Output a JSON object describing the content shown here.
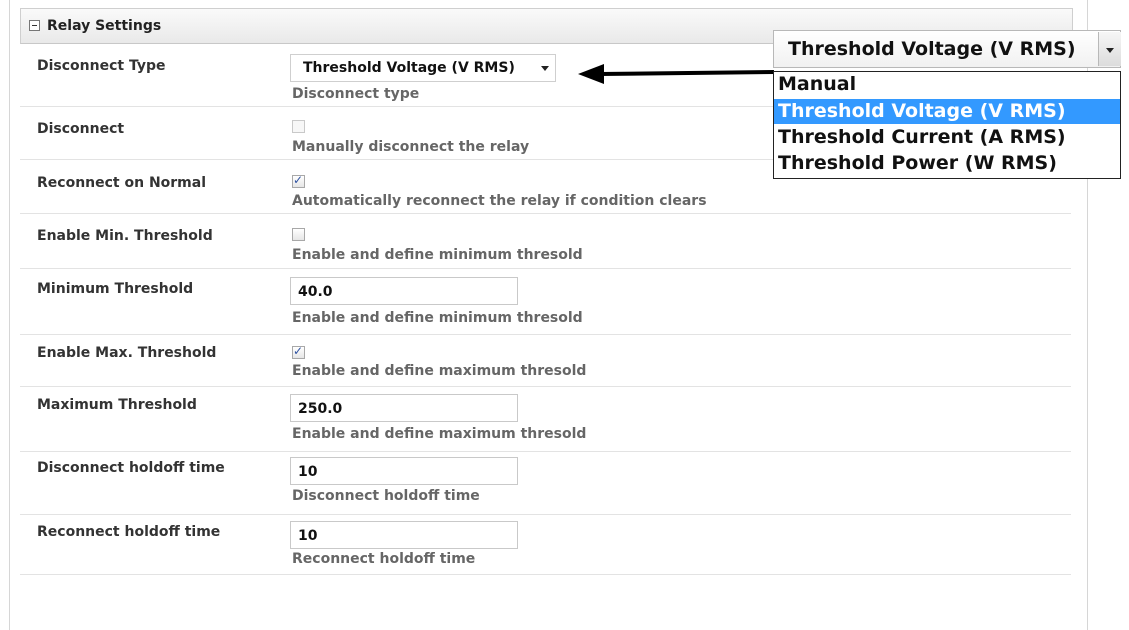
{
  "section": {
    "title": "Relay Settings"
  },
  "rows": [
    {
      "label": "Disconnect Type",
      "hint": "Disconnect type",
      "value": "Threshold Voltage (V RMS)"
    },
    {
      "label": "Disconnect",
      "hint": "Manually disconnect the relay",
      "checked": false
    },
    {
      "label": "Reconnect on Normal",
      "hint": "Automatically reconnect the relay if condition clears",
      "checked": true
    },
    {
      "label": "Enable Min. Threshold",
      "hint": "Enable and define minimum thresold",
      "checked": false
    },
    {
      "label": "Minimum Threshold",
      "hint": "Enable and define minimum thresold",
      "value": "40.0"
    },
    {
      "label": "Enable Max. Threshold",
      "hint": "Enable and define maximum thresold",
      "checked": true
    },
    {
      "label": "Maximum Threshold",
      "hint": "Enable and define maximum thresold",
      "value": "250.0"
    },
    {
      "label": "Disconnect holdoff time",
      "hint": "Disconnect holdoff time",
      "value": "10"
    },
    {
      "label": "Reconnect holdoff time",
      "hint": "Reconnect holdoff time",
      "value": "10"
    }
  ],
  "dropdown": {
    "selected": "Threshold Voltage (V RMS)",
    "options": [
      "Manual",
      "Threshold Voltage (V RMS)",
      "Threshold Current (A RMS)",
      "Threshold Power (W RMS)"
    ]
  },
  "colors": {
    "highlight": "#3399ff",
    "checkmark": "#2f52a0"
  },
  "icons": {
    "collapse": "minus-box-icon",
    "checkbox_check": "check-icon",
    "arrow": "left-arrow-icon"
  }
}
